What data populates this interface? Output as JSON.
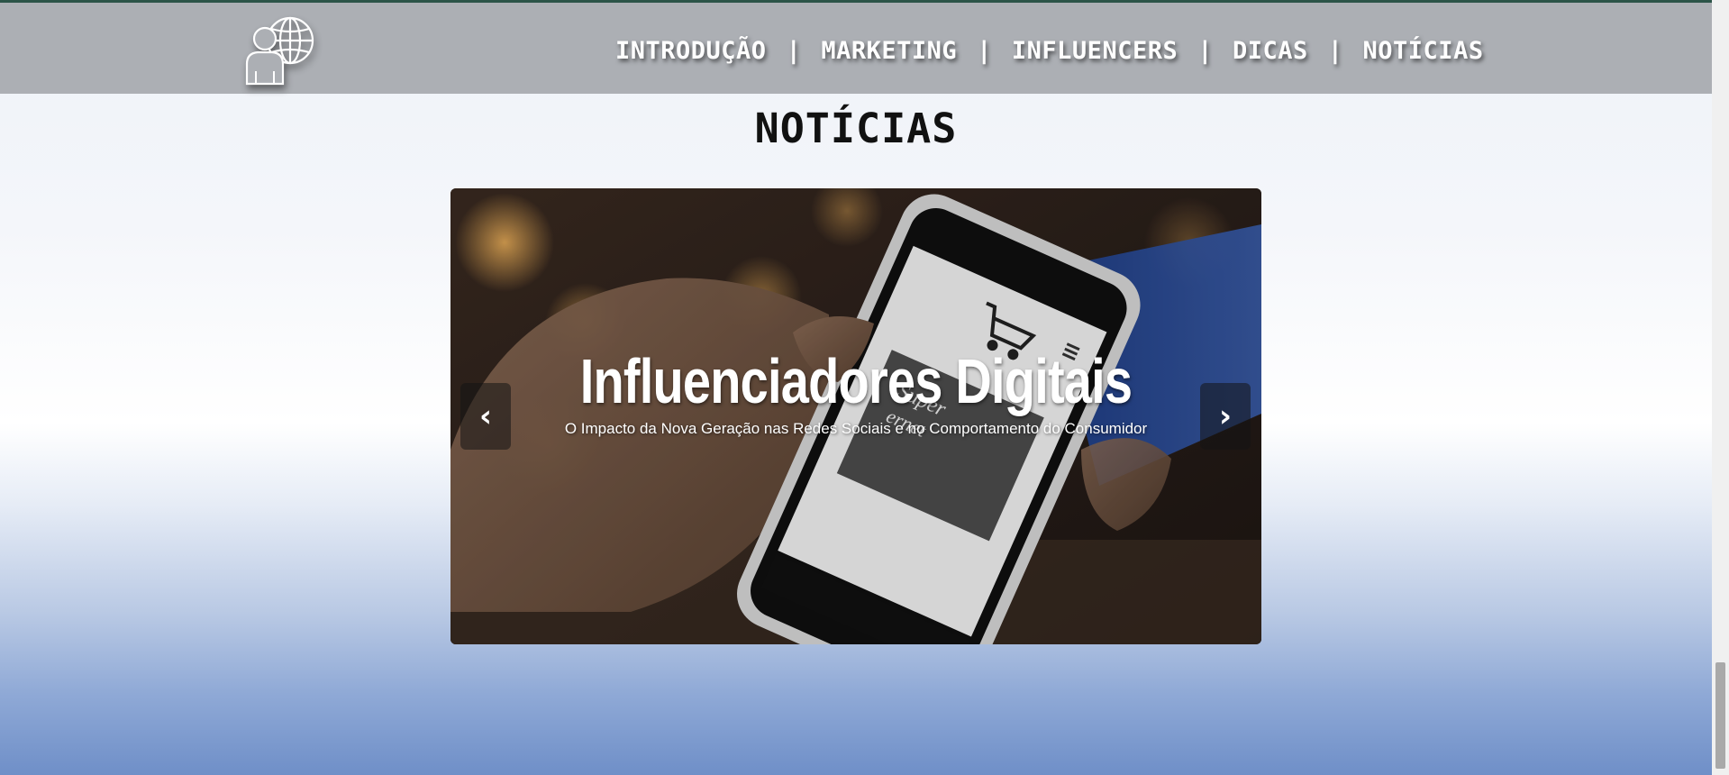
{
  "header": {
    "logo_icon": "person-globe-icon",
    "nav": [
      {
        "label": "INTRODUÇÃO"
      },
      {
        "label": "MARKETING"
      },
      {
        "label": "INFLUENCERS"
      },
      {
        "label": "DICAS"
      },
      {
        "label": "NOTÍCIAS"
      }
    ],
    "separator": "|"
  },
  "section": {
    "title": "NOTÍCIAS"
  },
  "carousel": {
    "slide": {
      "image": "hand-holding-smartphone-shopping-photo",
      "title": "Influenciadores Digitais",
      "subtitle": "O Impacto da Nova Geração nas Redes Sociais e no Comportamento do Consumidor"
    },
    "prev_glyph": "‹",
    "next_glyph": "›"
  },
  "colors": {
    "header_bg": "#acafb4",
    "top_accent": "#2c5448",
    "nav_text": "#ffffff",
    "title_text": "#111111"
  }
}
